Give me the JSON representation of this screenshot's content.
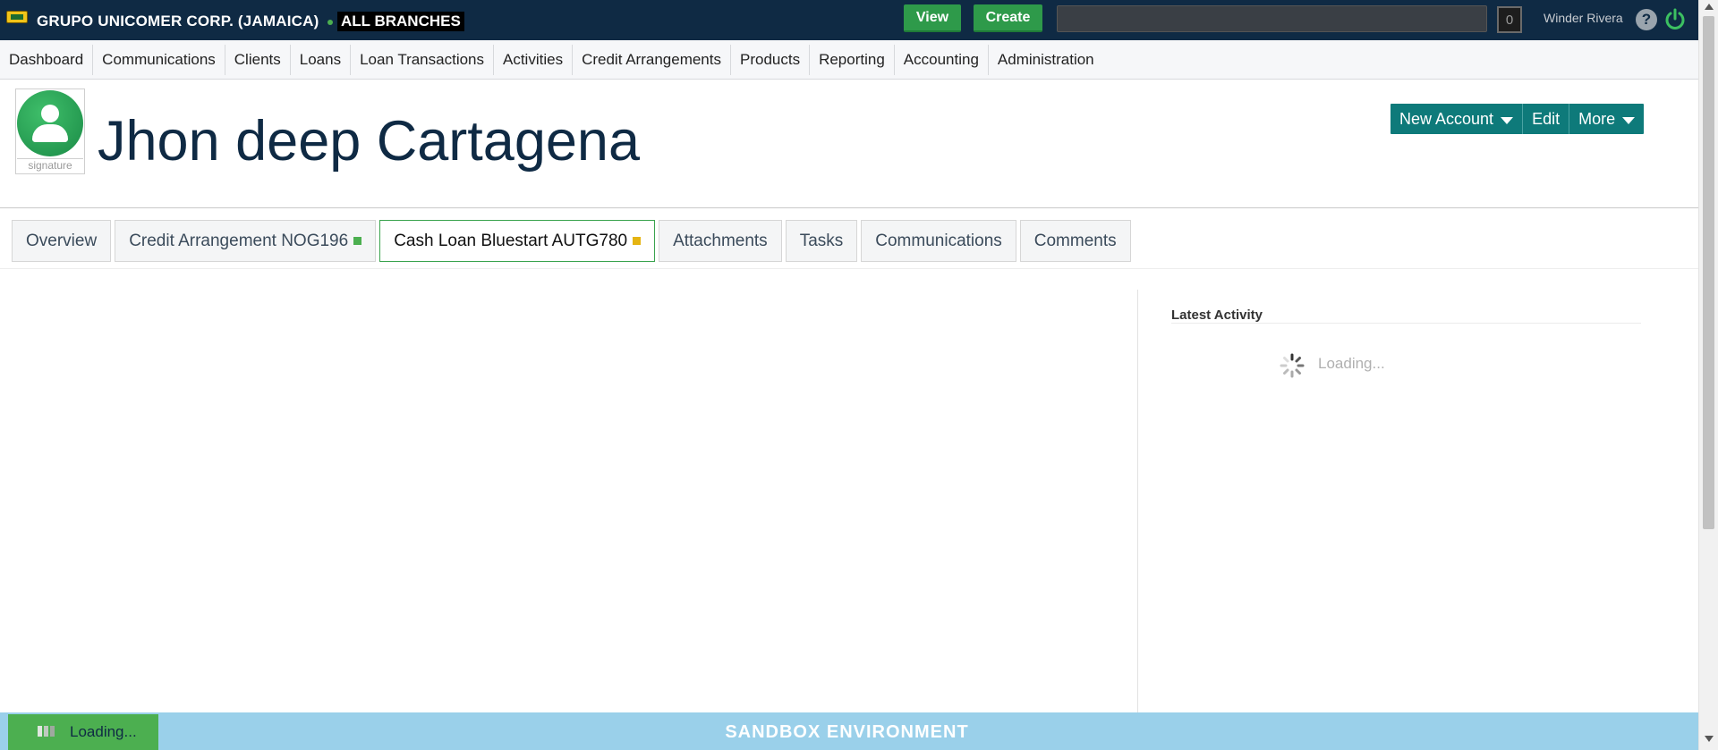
{
  "topbar": {
    "org_name": "GRUPO UNICOMER CORP. (JAMAICA)",
    "branch": "ALL BRANCHES",
    "view_label": "View",
    "create_label": "Create",
    "search_value": "",
    "counter": "0",
    "username": "Winder Rivera",
    "help_glyph": "?"
  },
  "nav": {
    "items": [
      "Dashboard",
      "Communications",
      "Clients",
      "Loans",
      "Loan Transactions",
      "Activities",
      "Credit Arrangements",
      "Products",
      "Reporting",
      "Accounting",
      "Administration"
    ]
  },
  "profile": {
    "name": "Jhon deep Cartagena",
    "avatar_caption": "signature"
  },
  "actions": {
    "new_account": "New Account",
    "edit": "Edit",
    "more": "More"
  },
  "tabs": [
    {
      "label": "Overview"
    },
    {
      "label": "Credit Arrangement NOG196",
      "status_color": "#4caf50"
    },
    {
      "label": "Cash Loan Bluestart AUTG780",
      "status_color": "#e5b412"
    },
    {
      "label": "Attachments"
    },
    {
      "label": "Tasks"
    },
    {
      "label": "Communications"
    },
    {
      "label": "Comments"
    }
  ],
  "activity": {
    "title": "Latest Activity",
    "loading": "Loading..."
  },
  "footer": {
    "environment": "SANDBOX ENVIRONMENT",
    "loading": "Loading..."
  },
  "colors": {
    "topbar": "#0f2a44",
    "accent_green": "#2e9a4a",
    "action_teal": "#0e7a7a",
    "footer": "#9ad0ea"
  }
}
